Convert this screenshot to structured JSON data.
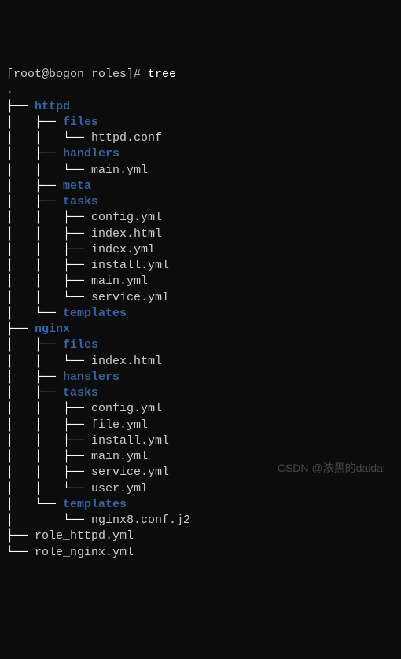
{
  "prompt": "[root@bogon roles]# ",
  "command": "tree",
  "root_dot": ".",
  "watermark": "CSDN @浓黑的daidai",
  "entries": [
    {
      "prefix": "├── ",
      "name": "httpd",
      "type": "dir"
    },
    {
      "prefix": "│   ├── ",
      "name": "files",
      "type": "dir"
    },
    {
      "prefix": "│   │   └── ",
      "name": "httpd.conf",
      "type": "file"
    },
    {
      "prefix": "│   ├── ",
      "name": "handlers",
      "type": "dir"
    },
    {
      "prefix": "│   │   └── ",
      "name": "main.yml",
      "type": "file"
    },
    {
      "prefix": "│   ├── ",
      "name": "meta",
      "type": "dir"
    },
    {
      "prefix": "│   ├── ",
      "name": "tasks",
      "type": "dir"
    },
    {
      "prefix": "│   │   ├── ",
      "name": "config.yml",
      "type": "file"
    },
    {
      "prefix": "│   │   ├── ",
      "name": "index.html",
      "type": "file"
    },
    {
      "prefix": "│   │   ├── ",
      "name": "index.yml",
      "type": "file"
    },
    {
      "prefix": "│   │   ├── ",
      "name": "install.yml",
      "type": "file"
    },
    {
      "prefix": "│   │   ├── ",
      "name": "main.yml",
      "type": "file"
    },
    {
      "prefix": "│   │   └── ",
      "name": "service.yml",
      "type": "file"
    },
    {
      "prefix": "│   └── ",
      "name": "templates",
      "type": "dir"
    },
    {
      "prefix": "├── ",
      "name": "nginx",
      "type": "dir"
    },
    {
      "prefix": "│   ├── ",
      "name": "files",
      "type": "dir"
    },
    {
      "prefix": "│   │   └── ",
      "name": "index.html",
      "type": "file"
    },
    {
      "prefix": "│   ├── ",
      "name": "hanslers",
      "type": "dir"
    },
    {
      "prefix": "│   ├── ",
      "name": "tasks",
      "type": "dir"
    },
    {
      "prefix": "│   │   ├── ",
      "name": "config.yml",
      "type": "file"
    },
    {
      "prefix": "│   │   ├── ",
      "name": "file.yml",
      "type": "file"
    },
    {
      "prefix": "│   │   ├── ",
      "name": "install.yml",
      "type": "file"
    },
    {
      "prefix": "│   │   ├── ",
      "name": "main.yml",
      "type": "file"
    },
    {
      "prefix": "│   │   ├── ",
      "name": "service.yml",
      "type": "file"
    },
    {
      "prefix": "│   │   └── ",
      "name": "user.yml",
      "type": "file"
    },
    {
      "prefix": "│   └── ",
      "name": "templates",
      "type": "dir"
    },
    {
      "prefix": "│       └── ",
      "name": "nginx8.conf.j2",
      "type": "file"
    },
    {
      "prefix": "├── ",
      "name": "role_httpd.yml",
      "type": "file"
    },
    {
      "prefix": "└── ",
      "name": "role_nginx.yml",
      "type": "file"
    }
  ]
}
